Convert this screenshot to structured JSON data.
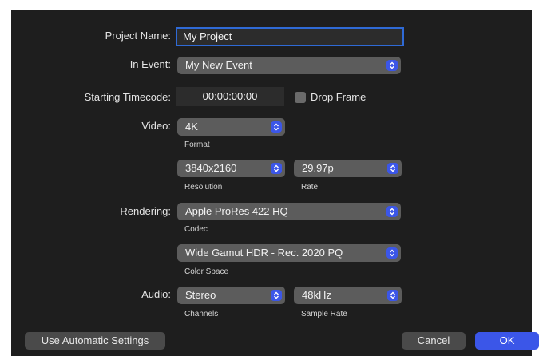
{
  "form": {
    "project_name": {
      "label": "Project Name:",
      "value": "My Project"
    },
    "in_event": {
      "label": "In Event:",
      "value": "My New Event"
    },
    "starting_timecode": {
      "label": "Starting Timecode:",
      "value": "00:00:00:00"
    },
    "drop_frame": {
      "label": "Drop Frame",
      "checked": false
    },
    "video": {
      "label": "Video:",
      "format": {
        "value": "4K",
        "caption": "Format"
      },
      "resolution": {
        "value": "3840x2160",
        "caption": "Resolution"
      },
      "rate": {
        "value": "29.97p",
        "caption": "Rate"
      }
    },
    "rendering": {
      "label": "Rendering:",
      "codec": {
        "value": "Apple ProRes 422 HQ",
        "caption": "Codec"
      },
      "color_space": {
        "value": "Wide Gamut HDR - Rec. 2020 PQ",
        "caption": "Color Space"
      }
    },
    "audio": {
      "label": "Audio:",
      "channels": {
        "value": "Stereo",
        "caption": "Channels"
      },
      "sample_rate": {
        "value": "48kHz",
        "caption": "Sample Rate"
      }
    }
  },
  "buttons": {
    "use_automatic": "Use Automatic Settings",
    "cancel": "Cancel",
    "ok": "OK"
  },
  "colors": {
    "background": "#1e1e1e",
    "accent": "#3b56e8",
    "focus_ring": "#2f6ad6",
    "popup": "#5c5c5c"
  }
}
